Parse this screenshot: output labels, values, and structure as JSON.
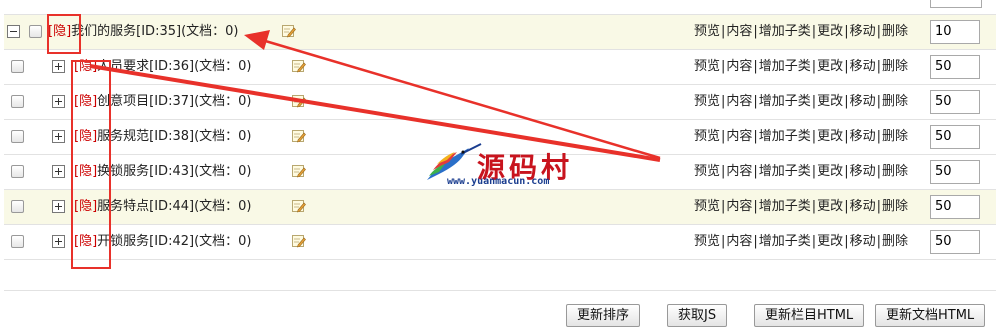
{
  "hidden_tag": "[隐]",
  "parent": {
    "name": "我们的服务[ID:35](文档：0)",
    "sort": "10"
  },
  "children": [
    {
      "name": "人员要求[ID:36](文档：0)",
      "sort": "50"
    },
    {
      "name": "创意项目[ID:37](文档：0)",
      "sort": "50"
    },
    {
      "name": "服务规范[ID:38](文档：0)",
      "sort": "50"
    },
    {
      "name": "换锁服务[ID:43](文档：0)",
      "sort": "50"
    },
    {
      "name": "服务特点[ID:44](文档：0)",
      "sort": "50"
    },
    {
      "name": "开锁服务[ID:42](文档：0)",
      "sort": "50"
    }
  ],
  "actions": {
    "preview": "预览",
    "content": "内容",
    "add_child": "增加子类",
    "edit": "更改",
    "move": "移动",
    "delete": "删除",
    "sep": "|"
  },
  "buttons": {
    "update_sort": "更新排序",
    "get_js": "获取JS",
    "update_column_html": "更新栏目HTML",
    "update_doc_html": "更新文档HTML"
  },
  "watermark": {
    "brand": "源码村",
    "url": "www.yuanmacun.com"
  },
  "colors": {
    "hidden_tag": "#cc0000",
    "annotation": "#e8312a",
    "row_highlight": "#f9f9e6"
  }
}
